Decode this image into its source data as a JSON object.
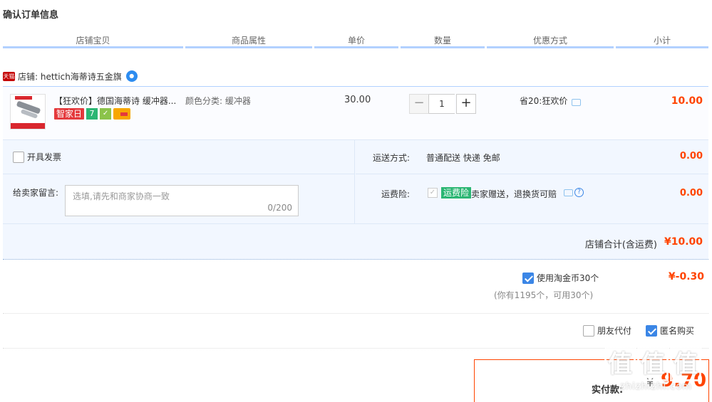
{
  "page_title": "确认订单信息",
  "columns": [
    "店铺宝贝",
    "商品属性",
    "单价",
    "数量",
    "优惠方式",
    "小计"
  ],
  "shop": {
    "badge": "天猫",
    "label": "店铺: hettich海蒂诗五金旗",
    "chat_icon": "chat-bubble-icon"
  },
  "item": {
    "title": "【狂欢价】德国海蒂诗 缓冲器...",
    "badges": [
      "智家日",
      "7",
      "✓",
      ""
    ],
    "attribute": "颜色分类: 缓冲器",
    "price": "30.00",
    "quantity": "1",
    "minus": "−",
    "plus": "+",
    "discount": "省20:狂欢价",
    "subtotal": "10.00"
  },
  "invoice": {
    "label": "开具发票"
  },
  "memo": {
    "label": "给卖家留言:",
    "placeholder": "选填,请先和商家协商一致",
    "count": "0/200"
  },
  "shipping": {
    "label": "运送方式:",
    "value": "普通配送 快递 免邮",
    "fee": "0.00"
  },
  "insurance": {
    "label": "运费险:",
    "check": "✓",
    "tag": "运费险",
    "text": "卖家赠送，退换货可赔",
    "help": "?",
    "fee": "0.00"
  },
  "shop_total": {
    "label": "店铺合计(含运费)",
    "value": "¥10.00"
  },
  "coins": {
    "label": "使用淘金币30个",
    "value": "¥-0.30",
    "note": "(你有1195个，可用30个)"
  },
  "options": {
    "friend_pay": "朋友代付",
    "anonymous": "匿名购买"
  },
  "payment": {
    "label": "实付款:",
    "currency": "¥",
    "amount": "9.70"
  },
  "watermark": {
    "chars": [
      "值",
      "值",
      "值"
    ],
    "text": "zhizhizhi.com"
  },
  "colors": {
    "accent_blue": "#b2d1ff",
    "price_red": "#ff4400",
    "check_blue": "#3b86e6",
    "insurance_green": "#2bb673"
  }
}
